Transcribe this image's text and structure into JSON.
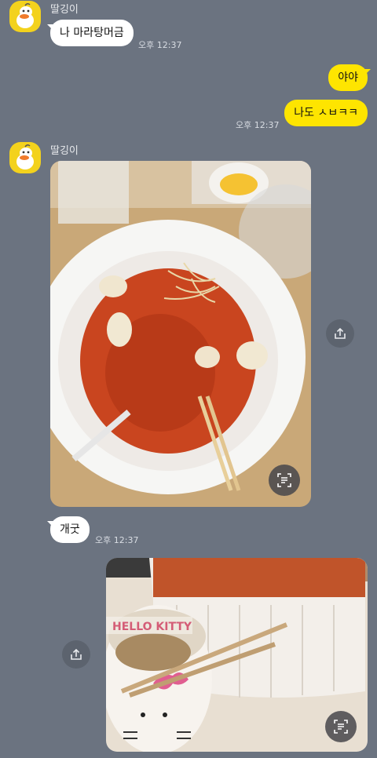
{
  "colors": {
    "background": "#6b7380",
    "bubble_in": "#ffffff",
    "bubble_out": "#fee500",
    "avatar": "#f3d21d"
  },
  "messages": [
    {
      "sender": "딸깅이",
      "text": "나 마라탕머금",
      "time": "오후 12:37"
    },
    {
      "text": "야야"
    },
    {
      "text": "나도 ㅅㅂㅋㅋ",
      "time": "오후 12:37"
    },
    {
      "sender": "딸깅이",
      "photo": "mala-tang-bowl"
    },
    {
      "text": "개굿",
      "time": "오후 12:37"
    },
    {
      "photo": "hello-kitty-bowl"
    }
  ],
  "icons": {
    "share": "share-icon",
    "text_scan": "text-scan-icon",
    "profile": "duck-avatar"
  }
}
